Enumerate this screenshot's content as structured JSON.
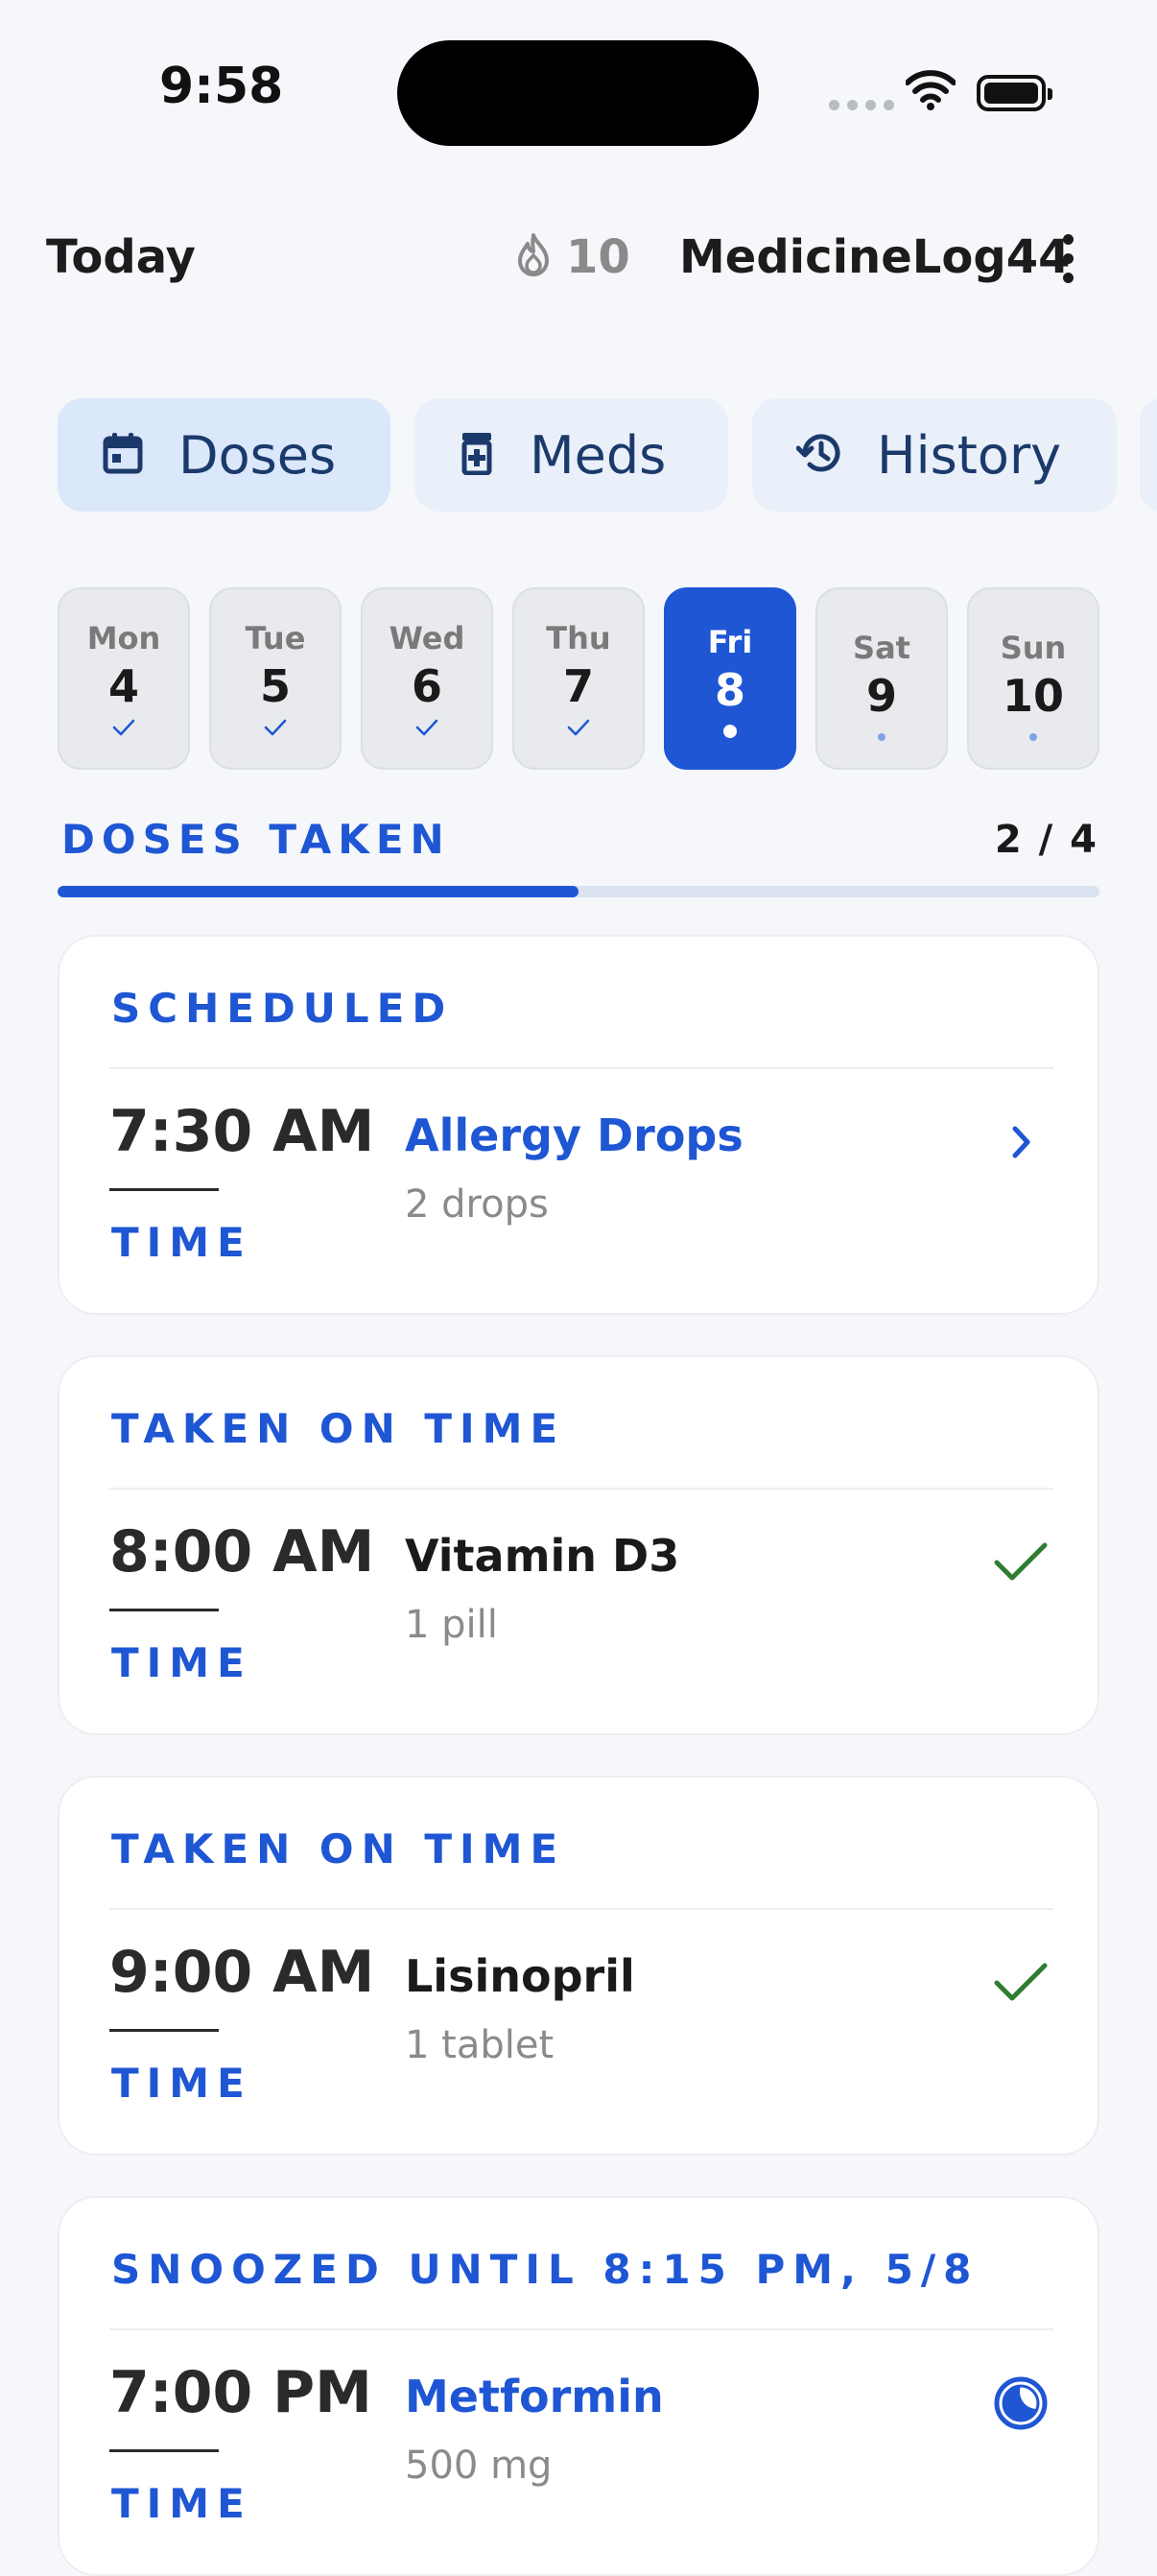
{
  "status_bar": {
    "time": "9:58"
  },
  "header": {
    "title": "Today",
    "streak_count": "10",
    "username": "MedicineLog44"
  },
  "tabs": [
    {
      "label": "Doses",
      "icon": "calendar-icon",
      "active": true
    },
    {
      "label": "Meds",
      "icon": "pill-bottle-icon",
      "active": false
    },
    {
      "label": "History",
      "icon": "history-icon",
      "active": false
    }
  ],
  "week": [
    {
      "name": "Mon",
      "num": "4",
      "mark": "check"
    },
    {
      "name": "Tue",
      "num": "5",
      "mark": "check"
    },
    {
      "name": "Wed",
      "num": "6",
      "mark": "check"
    },
    {
      "name": "Thu",
      "num": "7",
      "mark": "check"
    },
    {
      "name": "Fri",
      "num": "8",
      "mark": "dot",
      "selected": true
    },
    {
      "name": "Sat",
      "num": "9",
      "mark": "dot"
    },
    {
      "name": "Sun",
      "num": "10",
      "mark": "dot"
    }
  ],
  "progress": {
    "label": "DOSES TAKEN",
    "count": "2 / 4",
    "fraction": 0.5
  },
  "doses": [
    {
      "status": "SCHEDULED",
      "time": "7:30 AM",
      "time_caption": "TIME",
      "name": "Allergy Drops",
      "amount": "2 drops",
      "action_icon": "chevron-right-icon"
    },
    {
      "status": "TAKEN ON TIME",
      "time": "8:00 AM",
      "time_caption": "TIME",
      "name": "Vitamin D3",
      "amount": "1 pill",
      "action_icon": "checkmark-icon"
    },
    {
      "status": "TAKEN ON TIME",
      "time": "9:00 AM",
      "time_caption": "TIME",
      "name": "Lisinopril",
      "amount": "1 tablet",
      "action_icon": "checkmark-icon"
    },
    {
      "status": "SNOOZED UNTIL 8:15 PM, 5/8",
      "time": "7:00 PM",
      "time_caption": "TIME",
      "name": "Metformin",
      "amount": "500 mg",
      "action_icon": "snooze-clock-icon"
    }
  ],
  "colors": {
    "accent": "#1e56d4",
    "success": "#2e7d32",
    "background": "#f5f7fa"
  }
}
